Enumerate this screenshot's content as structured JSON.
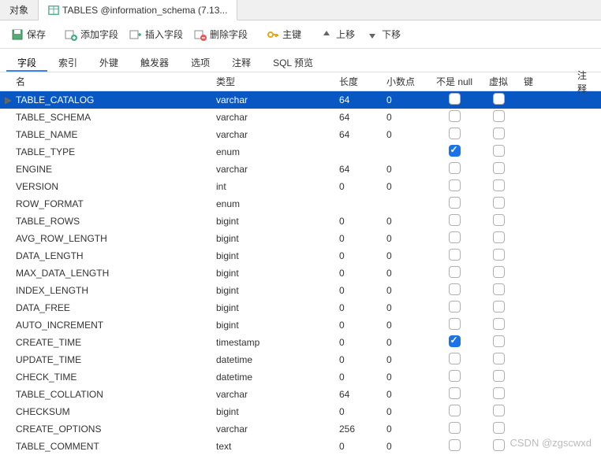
{
  "tabs": {
    "object": "对象",
    "active": "TABLES @information_schema (7.13..."
  },
  "toolbar": {
    "save": "保存",
    "add_field": "添加字段",
    "insert_field": "插入字段",
    "delete_field": "删除字段",
    "primary_key": "主键",
    "move_up": "上移",
    "move_down": "下移"
  },
  "subtabs": {
    "fields": "字段",
    "indexes": "索引",
    "fk": "外键",
    "triggers": "触发器",
    "options": "选项",
    "comment": "注释",
    "sql": "SQL 预览"
  },
  "columns": {
    "name": "名",
    "type": "类型",
    "length": "长度",
    "decimals": "小数点",
    "not_null": "不是 null",
    "virtual": "虚拟",
    "key": "键",
    "comment": "注释"
  },
  "rows": [
    {
      "name": "TABLE_CATALOG",
      "type": "varchar",
      "len": "64",
      "dec": "0",
      "nn": false,
      "virt": false,
      "selected": true
    },
    {
      "name": "TABLE_SCHEMA",
      "type": "varchar",
      "len": "64",
      "dec": "0",
      "nn": false,
      "virt": false
    },
    {
      "name": "TABLE_NAME",
      "type": "varchar",
      "len": "64",
      "dec": "0",
      "nn": false,
      "virt": false
    },
    {
      "name": "TABLE_TYPE",
      "type": "enum",
      "len": "",
      "dec": "",
      "nn": true,
      "virt": false
    },
    {
      "name": "ENGINE",
      "type": "varchar",
      "len": "64",
      "dec": "0",
      "nn": false,
      "virt": false
    },
    {
      "name": "VERSION",
      "type": "int",
      "len": "0",
      "dec": "0",
      "nn": false,
      "virt": false
    },
    {
      "name": "ROW_FORMAT",
      "type": "enum",
      "len": "",
      "dec": "",
      "nn": false,
      "virt": false
    },
    {
      "name": "TABLE_ROWS",
      "type": "bigint",
      "len": "0",
      "dec": "0",
      "nn": false,
      "virt": false
    },
    {
      "name": "AVG_ROW_LENGTH",
      "type": "bigint",
      "len": "0",
      "dec": "0",
      "nn": false,
      "virt": false
    },
    {
      "name": "DATA_LENGTH",
      "type": "bigint",
      "len": "0",
      "dec": "0",
      "nn": false,
      "virt": false
    },
    {
      "name": "MAX_DATA_LENGTH",
      "type": "bigint",
      "len": "0",
      "dec": "0",
      "nn": false,
      "virt": false
    },
    {
      "name": "INDEX_LENGTH",
      "type": "bigint",
      "len": "0",
      "dec": "0",
      "nn": false,
      "virt": false
    },
    {
      "name": "DATA_FREE",
      "type": "bigint",
      "len": "0",
      "dec": "0",
      "nn": false,
      "virt": false
    },
    {
      "name": "AUTO_INCREMENT",
      "type": "bigint",
      "len": "0",
      "dec": "0",
      "nn": false,
      "virt": false
    },
    {
      "name": "CREATE_TIME",
      "type": "timestamp",
      "len": "0",
      "dec": "0",
      "nn": true,
      "virt": false
    },
    {
      "name": "UPDATE_TIME",
      "type": "datetime",
      "len": "0",
      "dec": "0",
      "nn": false,
      "virt": false
    },
    {
      "name": "CHECK_TIME",
      "type": "datetime",
      "len": "0",
      "dec": "0",
      "nn": false,
      "virt": false
    },
    {
      "name": "TABLE_COLLATION",
      "type": "varchar",
      "len": "64",
      "dec": "0",
      "nn": false,
      "virt": false
    },
    {
      "name": "CHECKSUM",
      "type": "bigint",
      "len": "0",
      "dec": "0",
      "nn": false,
      "virt": false
    },
    {
      "name": "CREATE_OPTIONS",
      "type": "varchar",
      "len": "256",
      "dec": "0",
      "nn": false,
      "virt": false
    },
    {
      "name": "TABLE_COMMENT",
      "type": "text",
      "len": "0",
      "dec": "0",
      "nn": false,
      "virt": false
    }
  ],
  "watermark": "CSDN @zgscwxd"
}
